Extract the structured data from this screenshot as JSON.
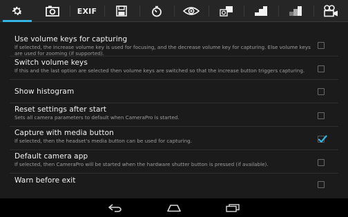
{
  "tabs": [
    {
      "name": "settings",
      "icon": "gear-icon",
      "active": true
    },
    {
      "name": "camera",
      "icon": "camera-icon",
      "active": false
    },
    {
      "name": "exif",
      "label": "EXIF",
      "active": false
    },
    {
      "name": "storage",
      "icon": "floppy-disk-icon",
      "active": false
    },
    {
      "name": "timer",
      "icon": "timer-icon",
      "active": false
    },
    {
      "name": "eye",
      "icon": "eye-icon",
      "active": false
    },
    {
      "name": "effects",
      "icon": "bw-effects-icon",
      "active": false
    },
    {
      "name": "stairs",
      "icon": "stairs-icon",
      "active": false
    },
    {
      "name": "gradient",
      "icon": "gradient-icon",
      "active": false
    },
    {
      "name": "video",
      "icon": "video-camera-icon",
      "active": false
    }
  ],
  "accent_color": "#33b5e5",
  "preferences": [
    {
      "title": "Use volume keys for capturing",
      "summary": "If selected, the increase volume key is used for focusing, and the decrease volume key for capturing. Else volume keys are used for zooming (if supported).",
      "checked": false
    },
    {
      "title": "Switch volume keys",
      "summary": "If this and the last option are selected then volume keys are switched so that the increase button triggers capturing.",
      "checked": false
    },
    {
      "title": "Show histogram",
      "summary": "",
      "checked": false
    },
    {
      "title": "Reset settings after start",
      "summary": "Sets all camera parameters to default when CameraPro is started.",
      "checked": false
    },
    {
      "title": "Capture with media button",
      "summary": "If selected, then the headset's media button can be used for capturing.",
      "checked": true
    },
    {
      "title": "Default camera app",
      "summary": "If selected, then CameraPro will be started when the hardware shutter button is pressed (if available).",
      "checked": false
    },
    {
      "title": "Warn before exit",
      "summary": "",
      "checked": false
    }
  ],
  "navbar": {
    "back": "back-icon",
    "home": "home-icon",
    "recents": "recent-apps-icon"
  }
}
